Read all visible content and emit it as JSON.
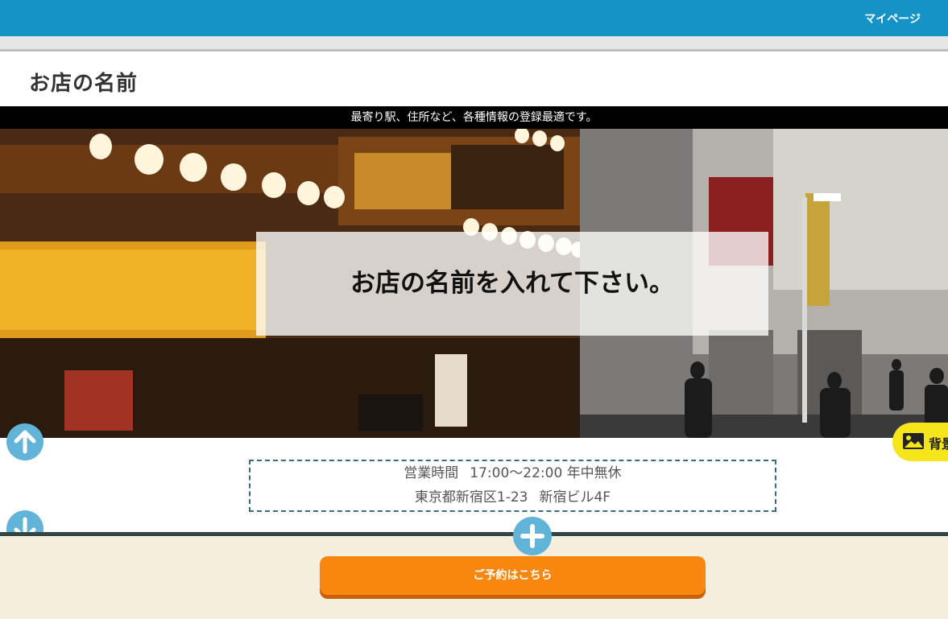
{
  "nav": {
    "mypage_label": "マイページ"
  },
  "shop": {
    "name": "お店の名前",
    "tagline": "最寄り駅、住所など、各種情報の登録最適です。"
  },
  "hero": {
    "headline": "お店の名前を入れて下さい。",
    "background_button_label": "背景"
  },
  "info": {
    "hours_label": "営業時間",
    "hours_value": "17:00～22:00",
    "closed": "年中無休",
    "address": "東京都新宿区1-23",
    "building": "新宿ビル4F"
  },
  "actions": {
    "reserve_label": "ご予約はこちら"
  },
  "icons": {
    "up": "arrow-up-icon",
    "down": "arrow-down-icon",
    "add": "plus-icon",
    "image": "image-icon"
  },
  "colors": {
    "topbar": "#1593c6",
    "accent_circle": "#62b3d8",
    "reserve_button": "#f7870f",
    "background_button": "#f5e51a",
    "cream": "#f6eedd"
  }
}
